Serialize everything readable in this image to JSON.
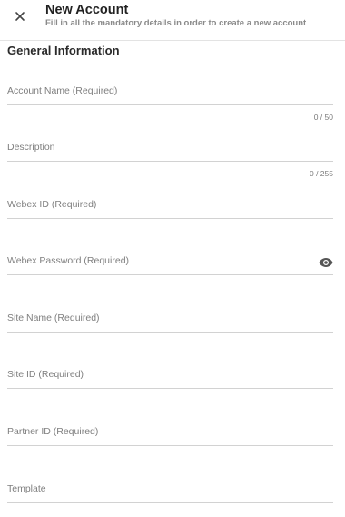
{
  "header": {
    "title": "New Account",
    "subtitle": "Fill in all the mandatory details in order to create a new account"
  },
  "section": {
    "title": "General Information"
  },
  "fields": {
    "account_name": {
      "placeholder": "Account Name  (Required)",
      "value": "",
      "counter": "0 / 50"
    },
    "description": {
      "placeholder": "Description",
      "value": "",
      "counter": "0 / 255"
    },
    "webex_id": {
      "placeholder": "Webex ID  (Required)",
      "value": ""
    },
    "webex_password": {
      "placeholder": "Webex Password (Required)",
      "value": ""
    },
    "site_name": {
      "placeholder": "Site Name  (Required)",
      "value": ""
    },
    "site_id": {
      "placeholder": "Site ID  (Required)",
      "value": ""
    },
    "partner_id": {
      "placeholder": "Partner ID  (Required)",
      "value": ""
    },
    "template": {
      "placeholder": "Template",
      "value": ""
    }
  },
  "icons": {
    "close": "close-icon",
    "eye": "eye-icon"
  }
}
